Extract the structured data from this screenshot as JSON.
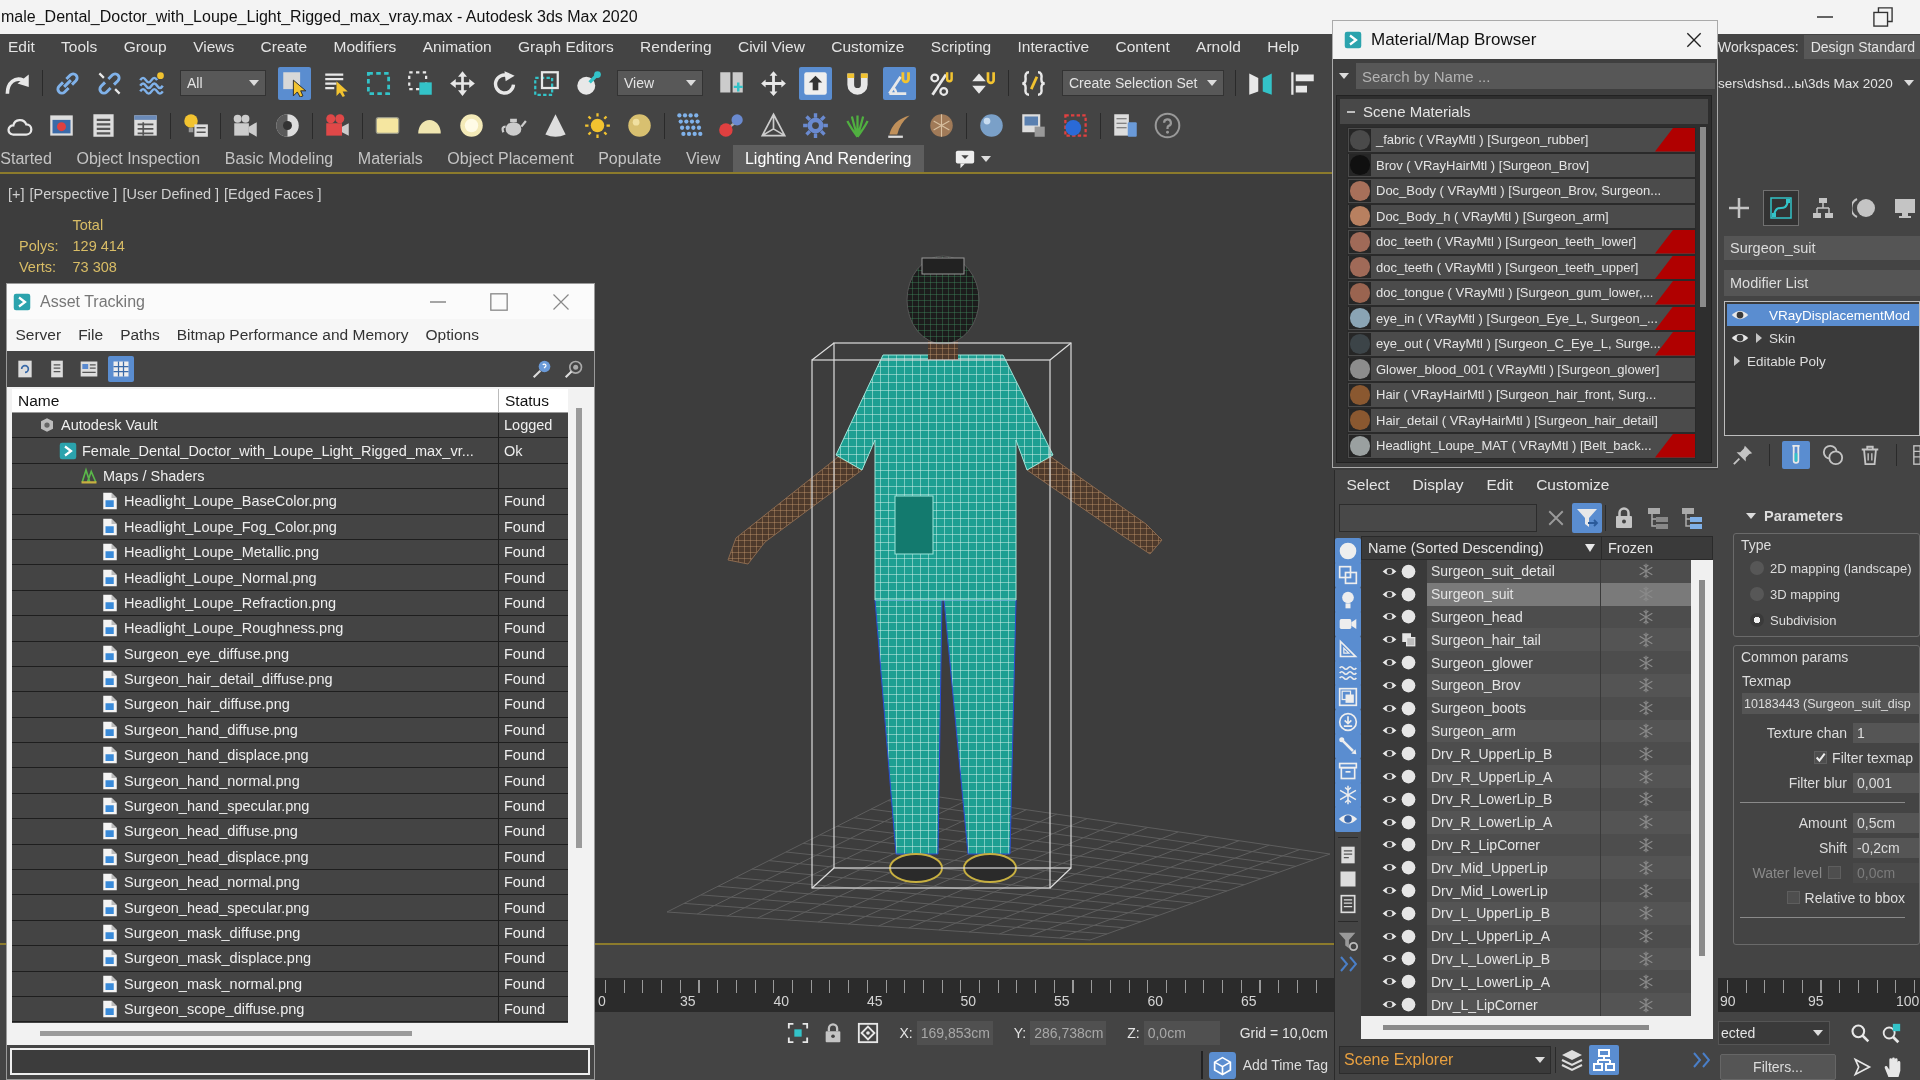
{
  "window": {
    "title": "male_Dental_Doctor_with_Loupe_Light_Rigged_max_vray.max - Autodesk 3ds Max 2020"
  },
  "menu_bar": {
    "items": [
      "Edit",
      "Tools",
      "Group",
      "Views",
      "Create",
      "Modifiers",
      "Animation",
      "Graph Editors",
      "Rendering",
      "Civil View",
      "Customize",
      "Scripting",
      "Interactive",
      "Content",
      "Arnold",
      "Help"
    ],
    "workspaces_label": "Workspaces:",
    "workspace": "Design Standard"
  },
  "main_toolbar": {
    "items": [
      {
        "kind": "button",
        "selected": false
      },
      {
        "kind": "button",
        "selected": false
      },
      {
        "kind": "button",
        "selected": false
      },
      {
        "kind": "button",
        "selected": false
      },
      {
        "kind": "dropdown",
        "value": "All"
      },
      {
        "kind": "button",
        "selected": true
      },
      {
        "kind": "button",
        "selected": false
      },
      {
        "kind": "button",
        "selected": false
      },
      {
        "kind": "button",
        "selected": false
      },
      {
        "kind": "button",
        "selected": false
      },
      {
        "kind": "button",
        "selected": false
      },
      {
        "kind": "button",
        "selected": false
      },
      {
        "kind": "button",
        "selected": false
      },
      {
        "kind": "dropdown",
        "value": "View"
      },
      {
        "kind": "button",
        "selected": false
      },
      {
        "kind": "button",
        "selected": false
      },
      {
        "kind": "button",
        "selected": true
      },
      {
        "kind": "button",
        "selected": false
      },
      {
        "kind": "button",
        "selected": true
      },
      {
        "kind": "button",
        "selected": false
      },
      {
        "kind": "button",
        "selected": false
      },
      {
        "kind": "button",
        "selected": false
      },
      {
        "kind": "dropdown",
        "value": "Create Selection Set"
      },
      {
        "kind": "button",
        "selected": false
      },
      {
        "kind": "button",
        "selected": false
      }
    ],
    "project_path": "sers\\dshsd...ы\\3ds Max 2020"
  },
  "ribbon": {
    "tabs": [
      {
        "label": "Started",
        "selected": false
      },
      {
        "label": "Object Inspection",
        "selected": false
      },
      {
        "label": "Basic Modeling",
        "selected": false
      },
      {
        "label": "Materials",
        "selected": false
      },
      {
        "label": "Object Placement",
        "selected": false
      },
      {
        "label": "Populate",
        "selected": false
      },
      {
        "label": "View",
        "selected": false
      },
      {
        "label": "Lighting And Rendering",
        "selected": true
      }
    ]
  },
  "viewport": {
    "labels": [
      "[+]",
      "[Perspective ]",
      "[User Defined ]",
      "[Edged Faces ]"
    ],
    "stats": {
      "heading": "Total",
      "rows": [
        {
          "label": "Polys:",
          "value": "129 414"
        },
        {
          "label": "Verts:",
          "value": "73 308"
        }
      ]
    }
  },
  "asset_tracking": {
    "title": "Asset Tracking",
    "menu": [
      "Server",
      "File",
      "Paths",
      "Bitmap Performance and Memory",
      "Options"
    ],
    "toolbar": [
      {
        "selected": false
      },
      {
        "selected": false
      },
      {
        "selected": false
      },
      {
        "selected": true
      }
    ],
    "columns": [
      "Name",
      "Status"
    ],
    "tree": [
      {
        "kind": "vault",
        "name": "Autodesk Vault",
        "status": "Logged",
        "children": [
          {
            "kind": "scene",
            "name": "Female_Dental_Doctor_with_Loupe_Light_Rigged_max_vr...",
            "status": "Ok",
            "children": [
              {
                "kind": "folder",
                "name": "Maps / Shaders",
                "children": [
                  {
                    "kind": "file",
                    "name": "Headlight_Loupe_BaseColor.png",
                    "status": "Found"
                  },
                  {
                    "kind": "file",
                    "name": "Headlight_Loupe_Fog_Color.png",
                    "status": "Found"
                  },
                  {
                    "kind": "file",
                    "name": "Headlight_Loupe_Metallic.png",
                    "status": "Found"
                  },
                  {
                    "kind": "file",
                    "name": "Headlight_Loupe_Normal.png",
                    "status": "Found"
                  },
                  {
                    "kind": "file",
                    "name": "Headlight_Loupe_Refraction.png",
                    "status": "Found"
                  },
                  {
                    "kind": "file",
                    "name": "Headlight_Loupe_Roughness.png",
                    "status": "Found"
                  },
                  {
                    "kind": "file",
                    "name": "Surgeon_eye_diffuse.png",
                    "status": "Found"
                  },
                  {
                    "kind": "file",
                    "name": "Surgeon_hair_detail_diffuse.png",
                    "status": "Found"
                  },
                  {
                    "kind": "file",
                    "name": "Surgeon_hair_diffuse.png",
                    "status": "Found"
                  },
                  {
                    "kind": "file",
                    "name": "Surgeon_hand_diffuse.png",
                    "status": "Found"
                  },
                  {
                    "kind": "file",
                    "name": "Surgeon_hand_displace.png",
                    "status": "Found"
                  },
                  {
                    "kind": "file",
                    "name": "Surgeon_hand_normal.png",
                    "status": "Found"
                  },
                  {
                    "kind": "file",
                    "name": "Surgeon_hand_specular.png",
                    "status": "Found"
                  },
                  {
                    "kind": "file",
                    "name": "Surgeon_head_diffuse.png",
                    "status": "Found"
                  },
                  {
                    "kind": "file",
                    "name": "Surgeon_head_displace.png",
                    "status": "Found"
                  },
                  {
                    "kind": "file",
                    "name": "Surgeon_head_normal.png",
                    "status": "Found"
                  },
                  {
                    "kind": "file",
                    "name": "Surgeon_head_specular.png",
                    "status": "Found"
                  },
                  {
                    "kind": "file",
                    "name": "Surgeon_mask_diffuse.png",
                    "status": "Found"
                  },
                  {
                    "kind": "file",
                    "name": "Surgeon_mask_displace.png",
                    "status": "Found"
                  },
                  {
                    "kind": "file",
                    "name": "Surgeon_mask_normal.png",
                    "status": "Found"
                  },
                  {
                    "kind": "file",
                    "name": "Surgeon_scope_diffuse.png",
                    "status": "Found"
                  }
                ]
              }
            ]
          }
        ]
      }
    ]
  },
  "material_browser": {
    "title": "Material/Map Browser",
    "search": {
      "placeholder": "Search by Name ..."
    },
    "group": "Scene Materials",
    "materials": [
      {
        "label": "_fabric ( VRayMtl ) [Surgeon_rubber]",
        "color": "#4a4a4a",
        "flagged": true
      },
      {
        "label": "Brov ( VRayHairMtl ) [Surgeon_Brov]",
        "color": "#101010",
        "flagged": false
      },
      {
        "label": "Doc_Body ( VRayMtl ) [Surgeon_Brov, Surgeon...",
        "color": "#a8705a",
        "flagged": false
      },
      {
        "label": "Doc_Body_h ( VRayMtl ) [Surgeon_arm]",
        "color": "#b88060",
        "flagged": false
      },
      {
        "label": "doc_teeth ( VRayMtl ) [Surgeon_teeth_lower]",
        "color": "#a06a58",
        "flagged": true
      },
      {
        "label": "doc_teeth ( VRayMtl ) [Surgeon_teeth_upper]",
        "color": "#a06a58",
        "flagged": true
      },
      {
        "label": "doc_tongue ( VRayMtl ) [Surgeon_gum_lower,...",
        "color": "#9a6450",
        "flagged": true
      },
      {
        "label": "eye_in ( VRayMtl ) [Surgeon_Eye_L, Surgeon_...",
        "color": "#8aa4b4",
        "flagged": true
      },
      {
        "label": "eye_out ( VRayMtl ) [Surgeon_C_Eye_L, Surge...",
        "color": "#3c4448",
        "flagged": true
      },
      {
        "label": "Glower_blood_001 ( VRayMtl ) [Surgeon_glower]",
        "color": "#8c8c8c",
        "flagged": false
      },
      {
        "label": "Hair ( VRayHairMtl ) [Surgeon_hair_front, Surg...",
        "color": "#8a5830",
        "flagged": false
      },
      {
        "label": "Hair_detail ( VRayHairMtl ) [Surgeon_hair_detail]",
        "color": "#8a5830",
        "flagged": false
      },
      {
        "label": "Headlight_Loupe_MAT ( VRayMtl ) [Belt_back...",
        "color": "#9aa0a0",
        "flagged": true
      }
    ]
  },
  "scene_explorer": {
    "menu": [
      "Select",
      "Display",
      "Edit",
      "Customize"
    ],
    "toolbar": [
      {
        "selected": true
      },
      {
        "selected": false
      },
      {
        "selected": false
      },
      {
        "selected": false
      }
    ],
    "filters": [
      {
        "selected": true
      },
      {
        "selected": true
      },
      {
        "selected": true
      },
      {
        "selected": true
      },
      {
        "selected": true
      },
      {
        "selected": true
      },
      {
        "selected": true
      },
      {
        "selected": true
      },
      {
        "selected": true
      },
      {
        "selected": true
      },
      {
        "selected": true
      },
      {
        "selected": true
      },
      {
        "selected": false
      },
      {
        "selected": false
      },
      {
        "selected": false
      }
    ],
    "columns": [
      "Name (Sorted Descending)",
      "Frozen"
    ],
    "rows": [
      {
        "name": "Surgeon_suit_detail",
        "kind": "mesh",
        "selected": false
      },
      {
        "name": "Surgeon_suit",
        "kind": "mesh",
        "selected": true
      },
      {
        "name": "Surgeon_head",
        "kind": "mesh",
        "selected": false
      },
      {
        "name": "Surgeon_hair_tail",
        "kind": "compound",
        "selected": false
      },
      {
        "name": "Surgeon_glower",
        "kind": "mesh",
        "selected": false
      },
      {
        "name": "Surgeon_Brov",
        "kind": "mesh",
        "selected": false
      },
      {
        "name": "Surgeon_boots",
        "kind": "mesh",
        "selected": false
      },
      {
        "name": "Surgeon_arm",
        "kind": "mesh",
        "selected": false
      },
      {
        "name": "Drv_R_UpperLip_B",
        "kind": "mesh",
        "selected": false
      },
      {
        "name": "Drv_R_UpperLip_A",
        "kind": "mesh",
        "selected": false
      },
      {
        "name": "Drv_R_LowerLip_B",
        "kind": "mesh",
        "selected": false
      },
      {
        "name": "Drv_R_LowerLip_A",
        "kind": "mesh",
        "selected": false
      },
      {
        "name": "Drv_R_LipCorner",
        "kind": "mesh",
        "selected": false
      },
      {
        "name": "Drv_Mid_UpperLip",
        "kind": "mesh",
        "selected": false
      },
      {
        "name": "Drv_Mid_LowerLip",
        "kind": "mesh",
        "selected": false
      },
      {
        "name": "Drv_L_UpperLip_B",
        "kind": "mesh",
        "selected": false
      },
      {
        "name": "Drv_L_UpperLip_A",
        "kind": "mesh",
        "selected": false
      },
      {
        "name": "Drv_L_LowerLip_B",
        "kind": "mesh",
        "selected": false
      },
      {
        "name": "Drv_L_LowerLip_A",
        "kind": "mesh",
        "selected": false
      },
      {
        "name": "Drv_L_LipCorner",
        "kind": "mesh",
        "selected": false
      }
    ],
    "footer": "Scene Explorer",
    "view_modes": [
      {
        "selected": false
      },
      {
        "selected": true
      }
    ]
  },
  "command_panel": {
    "tabs": [
      {
        "selected": false
      },
      {
        "selected": true
      },
      {
        "selected": false
      },
      {
        "selected": false
      },
      {
        "selected": false
      }
    ],
    "object_name": "Surgeon_suit",
    "modifier_list": "Modifier List",
    "stack": [
      {
        "name": "VRayDisplacementMod",
        "selected": true,
        "eye": true,
        "expandable": false
      },
      {
        "name": "Skin",
        "selected": false,
        "eye": true,
        "expandable": true
      },
      {
        "name": "Editable Poly",
        "selected": false,
        "eye": false,
        "expandable": true
      }
    ],
    "stack_tools": [
      {
        "selected": false
      },
      {
        "selected": true
      },
      {
        "selected": false
      },
      {
        "selected": false
      },
      {
        "selected": false
      }
    ],
    "parameters": {
      "title": "Parameters",
      "type_label": "Type",
      "types": [
        {
          "label": "2D mapping (landscape)",
          "selected": false
        },
        {
          "label": "3D mapping",
          "selected": false
        },
        {
          "label": "Subdivision",
          "selected": true
        }
      ],
      "common_label": "Common params",
      "texmap_label": "Texmap",
      "texmap": "10183443 (Surgeon_suit_disp",
      "rows": [
        {
          "kind": "number",
          "label": "Texture chan",
          "value": "1"
        },
        {
          "kind": "check",
          "label": "Filter texmap",
          "checked": true
        },
        {
          "kind": "number",
          "label": "Filter blur",
          "value": "0,001"
        },
        {
          "kind": "rule"
        },
        {
          "kind": "number",
          "label": "Amount",
          "value": "0,5cm"
        },
        {
          "kind": "number",
          "label": "Shift",
          "value": "-0,2cm"
        },
        {
          "kind": "check_number",
          "label": "Water level",
          "checked": false,
          "value": "0,0cm",
          "disabled": true
        },
        {
          "kind": "check",
          "label": "Relative to bbox",
          "checked": false
        },
        {
          "kind": "rule"
        }
      ]
    }
  },
  "timeline": {
    "left_labels": [
      "0",
      "35",
      "40",
      "45",
      "50",
      "55",
      "60",
      "65"
    ],
    "right_labels": [
      "90",
      "95",
      "100"
    ]
  },
  "status_bar": {
    "coords": [
      {
        "label": "X:",
        "value": "169,853cm"
      },
      {
        "label": "Y:",
        "value": "286,738cm"
      },
      {
        "label": "Z:",
        "value": "0,0cm"
      }
    ],
    "grid": "Grid = 10,0cm",
    "time_tag": "Add Time Tag",
    "selection_filter": "ected",
    "filters": "Filters..."
  }
}
